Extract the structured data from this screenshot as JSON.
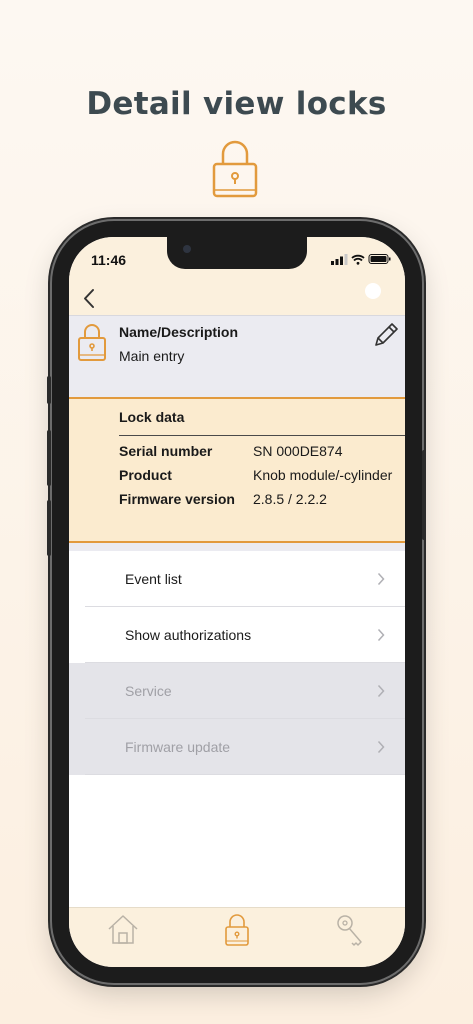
{
  "headline": "Detail view locks",
  "status_bar": {
    "time": "11:46"
  },
  "name_section": {
    "label": "Name/Description",
    "value": "Main entry"
  },
  "lock_data": {
    "title": "Lock data",
    "rows": [
      {
        "key": "Serial number",
        "value": "SN 000DE874"
      },
      {
        "key": "Product",
        "value": "Knob module/-cylinder"
      },
      {
        "key": "Firmware version",
        "value": "2.8.5 / 2.2.2"
      }
    ]
  },
  "menu": {
    "items": [
      {
        "label": "Event list",
        "enabled": true
      },
      {
        "label": "Show authorizations",
        "enabled": true
      },
      {
        "label": "Service",
        "enabled": false
      },
      {
        "label": "Firmware update",
        "enabled": false
      }
    ]
  },
  "tab_bar": {
    "tabs": [
      "home-icon",
      "lock-icon",
      "key-icon"
    ],
    "active": "lock-icon"
  },
  "colors": {
    "accent": "#e29a3d",
    "header_bg": "#fbf0dd",
    "lock_data_bg": "#fbebcf",
    "name_bg": "#ebebf1"
  },
  "icons": {
    "hero": "lock-icon",
    "back": "chevron-left-icon",
    "edit": "pencil-icon",
    "chevron": "chevron-right-icon"
  }
}
